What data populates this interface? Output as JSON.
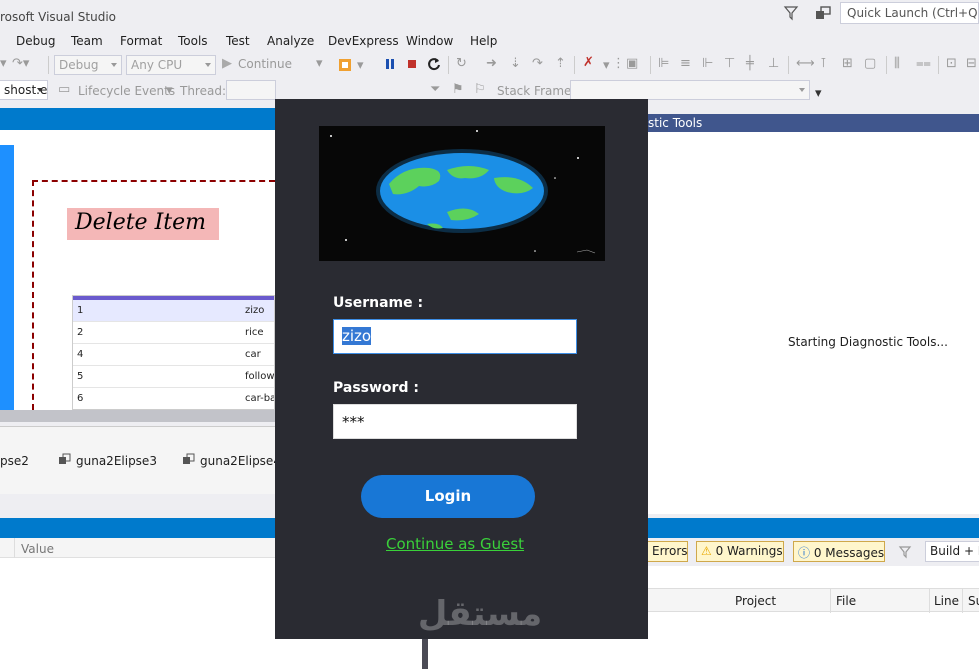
{
  "window": {
    "title": "rosoft Visual Studio",
    "quick_launch_placeholder": "Quick Launch (Ctrl+Q)"
  },
  "menu": [
    "Debug",
    "Team",
    "Format",
    "Tools",
    "Test",
    "Analyze",
    "DevExpress",
    "Window",
    "Help"
  ],
  "toolbar": {
    "config": "Debug",
    "platform": "Any CPU",
    "continue_label": "Continue",
    "process": "shost.e",
    "lifecycle_label": "Lifecycle Events",
    "thread_label": "Thread:",
    "stack_frame_label": "Stack Frame:"
  },
  "designer": {
    "title": "Delete Item",
    "rows": [
      {
        "id": "1",
        "name": "zizo"
      },
      {
        "id": "2",
        "name": "rice"
      },
      {
        "id": "4",
        "name": "car"
      },
      {
        "id": "5",
        "name": "followe"
      },
      {
        "id": "6",
        "name": "car-ba"
      }
    ],
    "tray": [
      "pse2",
      "guna2Elipse3",
      "guna2Elipse4"
    ]
  },
  "properties": {
    "value_header": "Value"
  },
  "diagnostics": {
    "title": "stic Tools",
    "status": "Starting Diagnostic Tools..."
  },
  "error_list": {
    "errors_label": "Errors",
    "warnings_label": "0 Warnings",
    "messages_label": "0 Messages",
    "build_combo": "Build + In",
    "columns": [
      "Project",
      "File",
      "Line",
      "Su"
    ]
  },
  "login": {
    "username_label": "Username :",
    "username_value": "zizo",
    "password_label": "Password :",
    "password_value": "***",
    "login_button": "Login",
    "guest_link": "Continue as Guest",
    "watermark": "mostaql.com"
  }
}
